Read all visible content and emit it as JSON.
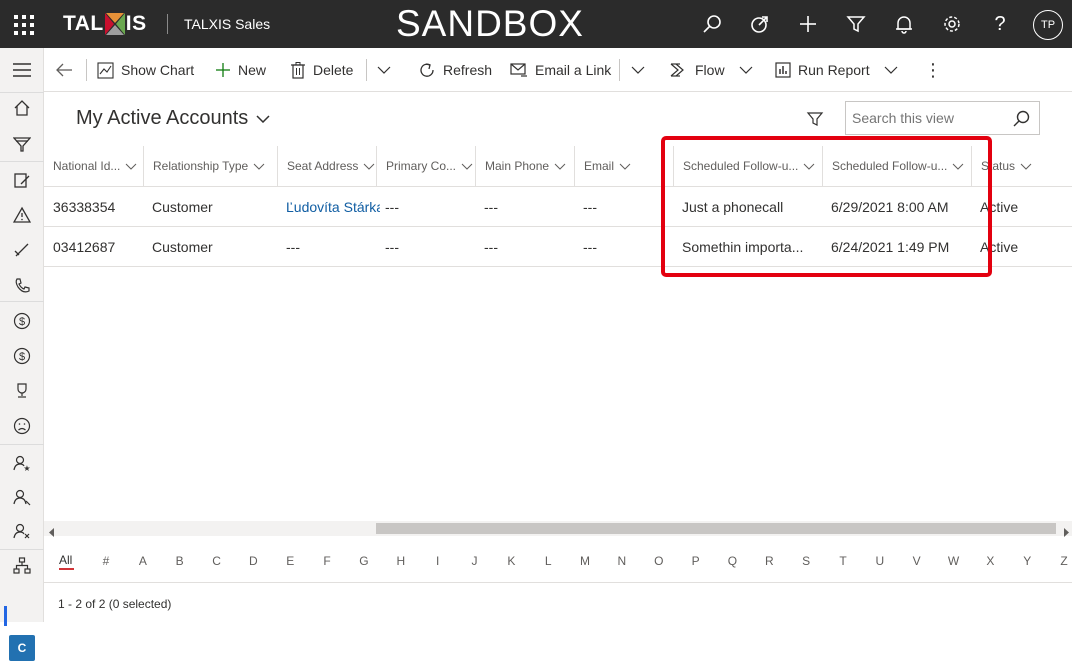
{
  "app": {
    "logo": "TAL  IS",
    "logo_left": "TAL",
    "logo_right": "IS",
    "app_name": "TALXIS Sales",
    "banner": "SANDBOX",
    "avatar_initials": "TP"
  },
  "commands": {
    "show_chart": "Show Chart",
    "new": "New",
    "delete": "Delete",
    "refresh": "Refresh",
    "email_link": "Email a Link",
    "flow": "Flow",
    "run_report": "Run Report"
  },
  "view": {
    "title": "My Active Accounts",
    "search_placeholder": "Search this view"
  },
  "columns": [
    "National Id...",
    "Relationship Type",
    "Seat Address",
    "Primary Co...",
    "Main Phone",
    "Email",
    "Scheduled Follow-u...",
    "Scheduled Follow-u...",
    "Status"
  ],
  "rows": [
    [
      "36338354",
      "Customer",
      "Ľudovíta Stárka",
      "---",
      "---",
      "---",
      "Just a phonecall",
      "6/29/2021 8:00 AM",
      "Active"
    ],
    [
      "03412687",
      "Customer",
      "---",
      "---",
      "---",
      "---",
      "Somethin importa...",
      "6/24/2021 1:49 PM",
      "Active"
    ]
  ],
  "jumpbar": {
    "all": "All",
    "letters": [
      "#",
      "A",
      "B",
      "C",
      "D",
      "E",
      "F",
      "G",
      "H",
      "I",
      "J",
      "K",
      "L",
      "M",
      "N",
      "O",
      "P",
      "Q",
      "R",
      "S",
      "T",
      "U",
      "V",
      "W",
      "X",
      "Y",
      "Z"
    ]
  },
  "footer": {
    "status": "1 - 2 of 2 (0 selected)"
  },
  "left_nav": {
    "bottom_badge": "C"
  },
  "colors": {
    "topbar": "#2b2b2b",
    "highlight": "#e3000f",
    "logo_red": "#c8102e",
    "logo_green": "#6aa84f",
    "link": "#115ea3"
  }
}
